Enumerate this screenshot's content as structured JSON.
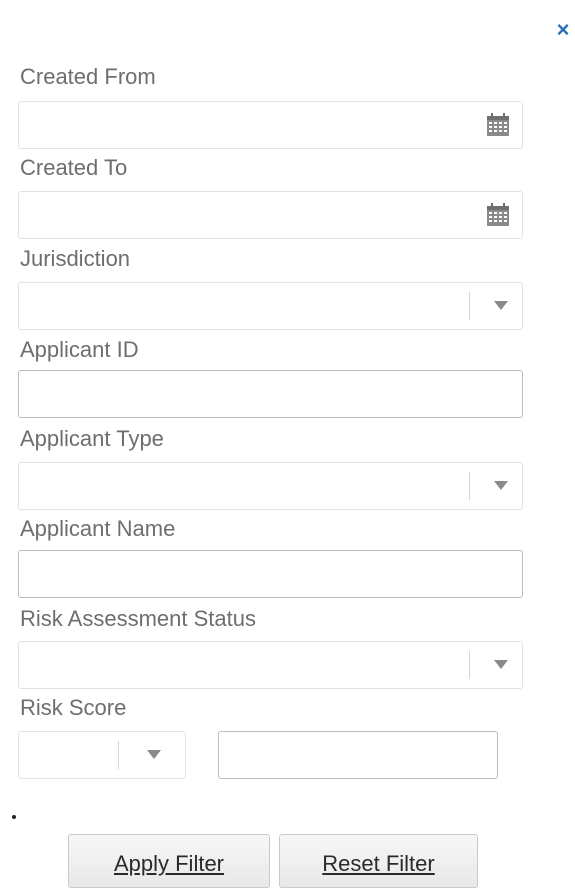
{
  "header": {
    "close_glyph": "×"
  },
  "fields": {
    "created_from": {
      "label": "Created From",
      "value": "",
      "icon": "calendar-icon"
    },
    "created_to": {
      "label": "Created To",
      "value": "",
      "icon": "calendar-icon"
    },
    "jurisdiction": {
      "label": "Jurisdiction",
      "value": ""
    },
    "applicant_id": {
      "label": "Applicant ID",
      "value": ""
    },
    "applicant_type": {
      "label": "Applicant Type",
      "value": ""
    },
    "applicant_name": {
      "label": "Applicant Name",
      "value": ""
    },
    "risk_assessment_status": {
      "label": "Risk Assessment Status",
      "value": ""
    },
    "risk_score": {
      "label": "Risk Score",
      "operator_value": "",
      "value": ""
    }
  },
  "buttons": {
    "apply": "Apply Filter",
    "reset": "Reset Filter"
  },
  "colors": {
    "close_icon": "#2a6ebb",
    "label_text": "#6e6e6e"
  }
}
